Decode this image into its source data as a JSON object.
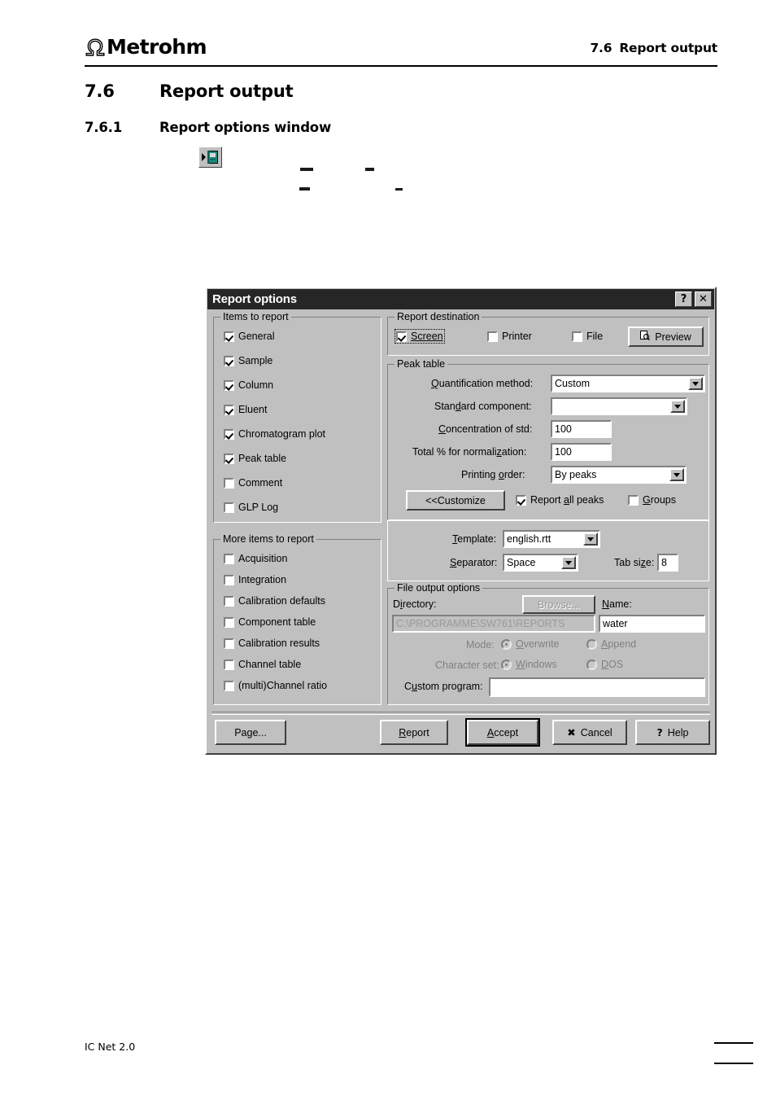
{
  "page": {
    "logo_brand": "Metrohm",
    "header_section_number": "7.6",
    "header_section_title": "Report output",
    "h1_number": "7.6",
    "h1_title": "Report output",
    "h2_number": "7.6.1",
    "h2_title": "Report options window",
    "footer": "IC Net 2.0"
  },
  "toolbar": {
    "icon": "report-output-toolbar-icon"
  },
  "dialog": {
    "title": "Report options",
    "help_button": "?",
    "close_button": "✕",
    "items_to_report": {
      "legend": "Items to report",
      "items": [
        {
          "label": "General",
          "checked": true
        },
        {
          "label": "Sample",
          "checked": true
        },
        {
          "label": "Column",
          "checked": true
        },
        {
          "label": "Eluent",
          "checked": true
        },
        {
          "label": "Chromatogram plot",
          "checked": true
        },
        {
          "label": "Peak table",
          "checked": true
        },
        {
          "label": "Comment",
          "checked": false
        },
        {
          "label": "GLP Log",
          "checked": false
        }
      ]
    },
    "more_items_to_report": {
      "legend": "More items to report",
      "items": [
        {
          "label": "Acquisition",
          "checked": false
        },
        {
          "label": "Integration",
          "checked": false
        },
        {
          "label": "Calibration defaults",
          "checked": false
        },
        {
          "label": "Component table",
          "checked": false
        },
        {
          "label": "Calibration results",
          "checked": false
        },
        {
          "label": "Channel table",
          "checked": false
        },
        {
          "label": "(multi)Channel ratio",
          "checked": false
        }
      ]
    },
    "report_destination": {
      "legend": "Report destination",
      "screen_label": "Screen",
      "screen_checked": true,
      "printer_label": "Printer",
      "printer_checked": false,
      "file_label": "File",
      "file_checked": false,
      "preview_label": "Preview"
    },
    "peak_table": {
      "legend": "Peak table",
      "quantification_method_label": "Quantification method:",
      "quantification_method_value": "Custom",
      "standard_component_label": "Standard component:",
      "standard_component_value": "",
      "concentration_of_std_label": "Concentration of std:",
      "concentration_of_std_value": "100",
      "total_pct_label": "Total % for normalization:",
      "total_pct_value": "100",
      "printing_order_label": "Printing order:",
      "printing_order_value": "By peaks",
      "customize_label": "<<Customize",
      "report_all_peaks_label": "Report all peaks",
      "report_all_peaks_checked": true,
      "groups_label": "Groups",
      "groups_checked": false
    },
    "template_section": {
      "template_label": "Template:",
      "template_value": "english.rtt",
      "separator_label": "Separator:",
      "separator_value": "Space",
      "tab_size_label": "Tab size:",
      "tab_size_value": "8"
    },
    "file_output_options": {
      "legend": "File output options",
      "directory_label": "Directory:",
      "directory_value": "C:\\PROGRAMME\\SW761\\REPORTS",
      "browse_label": "Browse...",
      "name_label": "Name:",
      "name_value": "water",
      "mode_label": "Mode:",
      "mode_overwrite_label": "Overwrite",
      "mode_overwrite_selected": true,
      "mode_append_label": "Append",
      "mode_append_selected": false,
      "character_set_label": "Character set:",
      "charset_windows_label": "Windows",
      "charset_windows_selected": true,
      "charset_dos_label": "DOS",
      "charset_dos_selected": false,
      "custom_program_label": "Custom program:",
      "custom_program_value": ""
    },
    "buttons": {
      "page_label": "Page...",
      "report_label": "Report",
      "accept_label": "Accept",
      "cancel_label": "Cancel",
      "cancel_glyph": "✖",
      "help_label": "Help",
      "help_glyph": "?"
    }
  }
}
